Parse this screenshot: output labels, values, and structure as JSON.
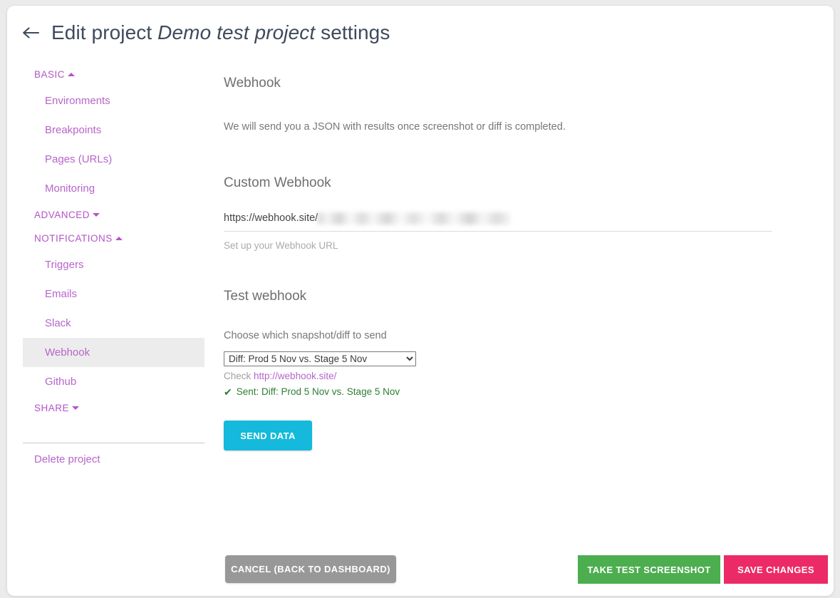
{
  "header": {
    "back_icon": "arrow-left-icon",
    "title_prefix": "Edit project ",
    "title_project": "Demo test project",
    "title_suffix": " settings"
  },
  "sidebar": {
    "groups": [
      {
        "label": "BASIC",
        "caret": "caret-up-icon",
        "items": [
          {
            "label": "Environments",
            "active": false
          },
          {
            "label": "Breakpoints",
            "active": false
          },
          {
            "label": "Pages (URLs)",
            "active": false
          },
          {
            "label": "Monitoring",
            "active": false
          }
        ]
      },
      {
        "label": "ADVANCED",
        "caret": "caret-down-icon",
        "items": []
      },
      {
        "label": "NOTIFICATIONS",
        "caret": "caret-up-icon",
        "items": [
          {
            "label": "Triggers",
            "active": false
          },
          {
            "label": "Emails",
            "active": false
          },
          {
            "label": "Slack",
            "active": false
          },
          {
            "label": "Webhook",
            "active": true
          },
          {
            "label": "Github",
            "active": false
          }
        ]
      },
      {
        "label": "SHARE",
        "caret": "caret-down-icon",
        "items": []
      }
    ],
    "delete_project_label": "Delete project"
  },
  "main": {
    "webhook": {
      "title": "Webhook",
      "description": "We will send you a JSON with results once screenshot or diff is completed."
    },
    "custom_webhook": {
      "title": "Custom Webhook",
      "url_value": "https://webhook.site/",
      "url_redacted": true,
      "hint": "Set up your Webhook URL"
    },
    "test_webhook": {
      "title": "Test webhook",
      "choose_label": "Choose which snapshot/diff to send",
      "select_value": "Diff: Prod 5 Nov vs. Stage 5 Nov",
      "select_options": [
        "Diff: Prod 5 Nov vs. Stage 5 Nov"
      ],
      "check_prefix": "Check ",
      "check_link": "http://webhook.site/",
      "sent_check_icon": "check-icon",
      "sent_text": "Sent: Diff: Prod 5 Nov vs. Stage 5 Nov",
      "send_button": "SEND DATA"
    }
  },
  "footer": {
    "cancel_label": "CANCEL (BACK TO DASHBOARD)",
    "screenshot_label": "TAKE TEST SCREENSHOT",
    "save_label": "SAVE CHANGES"
  },
  "colors": {
    "accent_purple": "#b765cb",
    "send_cyan": "#14b9db",
    "cancel_grey": "#989898",
    "screenshot_green": "#4cae4f",
    "save_pink": "#ec2a68",
    "sent_green": "#2e7d32",
    "page_bg": "#ebebeb",
    "title_navy": "#3e4a5c"
  }
}
